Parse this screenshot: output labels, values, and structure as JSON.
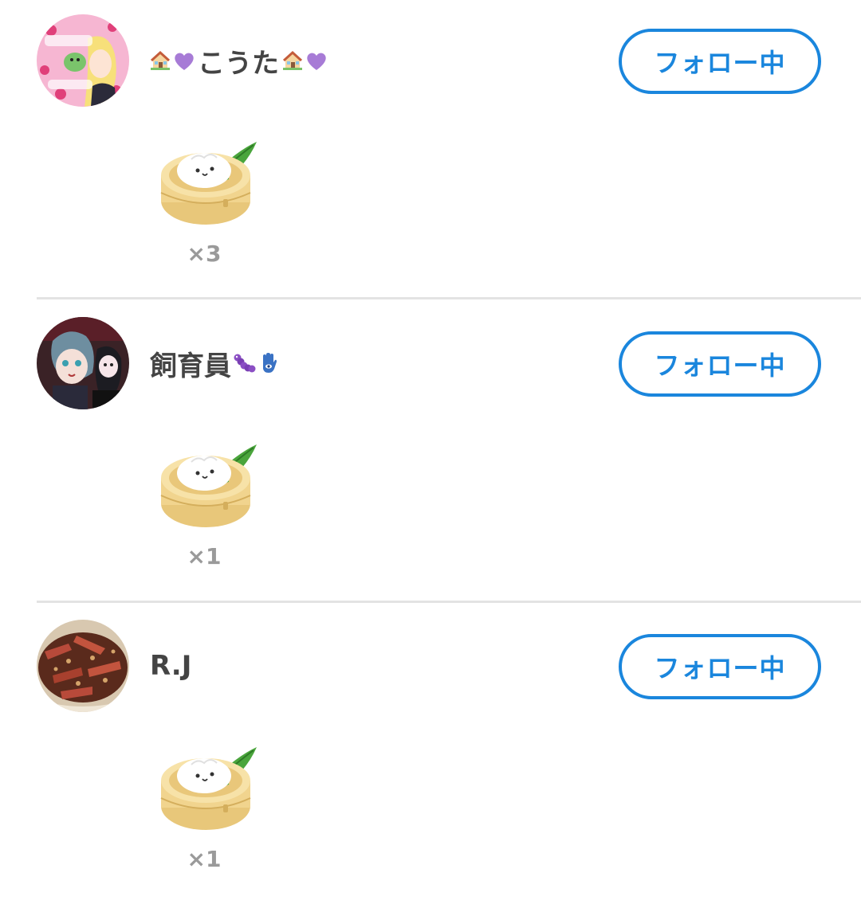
{
  "gift_rows": [
    {
      "user_name_prefix_icons": [
        "house-with-garden-icon",
        "purple-heart-icon"
      ],
      "user_name": "こうた",
      "user_name_suffix_icons": [
        "house-with-garden-icon",
        "purple-heart-icon"
      ],
      "follow_label": "フォロー中",
      "gift_icon": "steamed-bun-gift-icon",
      "gift_count": "×3"
    },
    {
      "user_name_prefix_icons": [],
      "user_name": "飼育員",
      "user_name_suffix_icons": [
        "caterpillar-icon",
        "hamsa-icon"
      ],
      "follow_label": "フォロー中",
      "gift_icon": "steamed-bun-gift-icon",
      "gift_count": "×1"
    },
    {
      "user_name_prefix_icons": [],
      "user_name": "R.J",
      "user_name_suffix_icons": [],
      "follow_label": "フォロー中",
      "gift_icon": "steamed-bun-gift-icon",
      "gift_count": "×1"
    }
  ],
  "colors": {
    "accent": "#1a86dd",
    "name_text": "#444444",
    "count_text": "#9a9a9a",
    "divider": "#e3e3e3"
  }
}
